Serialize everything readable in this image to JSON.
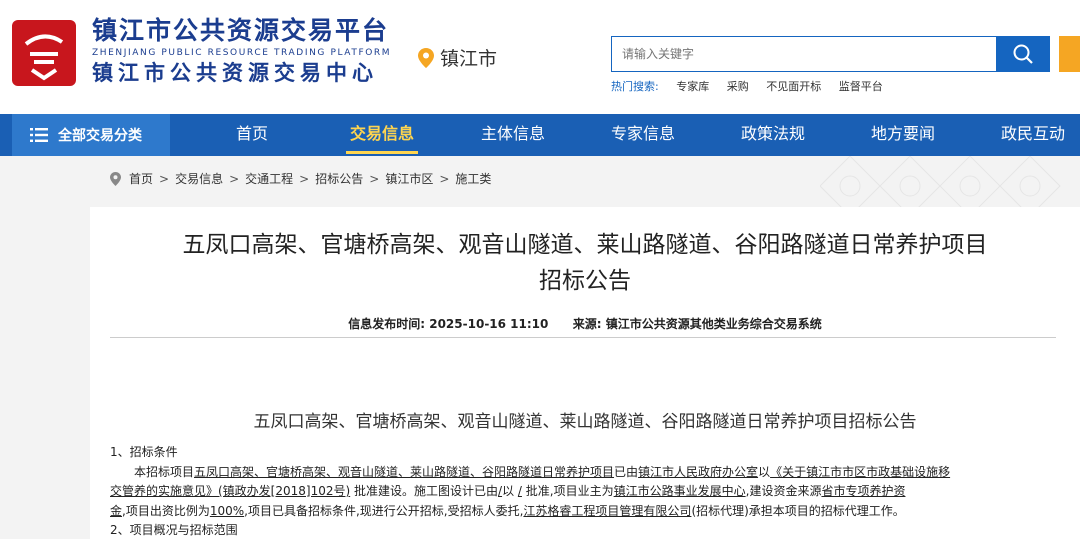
{
  "header": {
    "logo_cn_1": "镇江市公共资源交易平台",
    "logo_en": "ZHENJIANG PUBLIC RESOURCE TRADING PLATFORM",
    "logo_cn_2": "镇江市公共资源交易中心",
    "location": "镇江市",
    "search_placeholder": "请输入关键字",
    "hot_label": "热门搜索:",
    "hot_keywords": [
      "专家库",
      "采购",
      "不见面开标",
      "监督平台"
    ]
  },
  "nav": {
    "all_label": "全部交易分类",
    "items": [
      "首页",
      "交易信息",
      "主体信息",
      "专家信息",
      "政策法规",
      "地方要闻",
      "政民互动"
    ],
    "active": "交易信息"
  },
  "breadcrumb": [
    "首页",
    "交易信息",
    "交通工程",
    "招标公告",
    "镇江市区",
    "施工类"
  ],
  "article": {
    "title_line1": "五凤口高架、官塘桥高架、观音山隧道、莱山路隧道、谷阳路隧道日常养护项目",
    "title_line2": "招标公告",
    "publish_label": "信息发布时间:",
    "publish_time": "2025-10-16 11:10",
    "source_label": "来源:",
    "source": "镇江市公共资源其他类业务综合交易系统",
    "subtitle": "五凤口高架、官塘桥高架、观音山隧道、莱山路隧道、谷阳路隧道日常养护项目招标公告",
    "section1": "1、招标条件",
    "p1_a": "本招标项目",
    "p1_project": "五凤口高架、官塘桥高架、观音山隧道、莱山路隧道、谷阳路隧道日常养护项目",
    "p1_b": "已由",
    "p1_office": "镇江市人民政府办公室",
    "p1_c": "以",
    "p1_doc_a": "《关于镇江市市区市政基础设施移",
    "p2_doc_b": "交管养的实施意见》(镇政办发[2018]102号)",
    "p2_a": "批准建设。施工图设计已由",
    "p2_approver": "/",
    "p2_b": "以",
    "p2_num": "/",
    "p2_c": "批准,项目业主为",
    "p2_owner": "镇江市公路事业发展中心",
    "p2_d": ",建设资金来源",
    "p2_fund_a": "省市专项养护资",
    "p3_fund_b": "金",
    "p3_a": ",项目出资比例为",
    "p3_ratio": "100%",
    "p3_b": ",项目已具备招标条件,现进行公开招标,受招标人委托,",
    "p3_agent": "江苏格睿工程项目管理有限公司",
    "p3_c": "(招标代理)承担本项目的招标代理工作。",
    "section2": "2、项目概况与招标范围"
  }
}
